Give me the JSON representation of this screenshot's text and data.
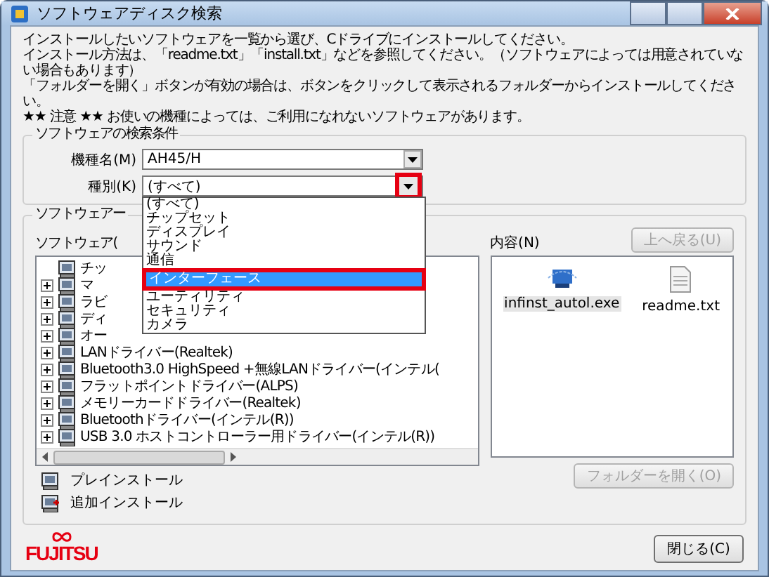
{
  "window": {
    "title": "ソフトウェアディスク検索"
  },
  "instructions": [
    "インストールしたいソフトウェアを一覧から選び、Cドライブにインストールしてください。",
    "インストール方法は、「readme.txt」「install.txt」などを参照してください。（ソフトウェアによっては用意されていない場合もあります）",
    "「フォルダーを開く」ボタンが有効の場合は、ボタンをクリックして表示されるフォルダーからインストールしてください。",
    "★★ 注意 ★★ お使いの機種によっては、ご利用になれないソフトウェアがあります。"
  ],
  "search_conditions": {
    "title": "ソフトウェアの検索条件",
    "fields": [
      {
        "label": "機種名(M)",
        "value": "AH45/H",
        "highlighted": false
      },
      {
        "label": "種別(K)",
        "value": "(すべて)",
        "highlighted": true,
        "expanded": true
      }
    ],
    "dropdown": [
      {
        "label": "(すべて)",
        "selected": false
      },
      {
        "label": "チップセット",
        "selected": false
      },
      {
        "label": "ディスプレイ",
        "selected": false
      },
      {
        "label": "サウンド",
        "selected": false
      },
      {
        "label": "通信",
        "selected": false
      },
      {
        "label": "インターフェース",
        "selected": true
      },
      {
        "label": "ユーティリティ",
        "selected": false
      },
      {
        "label": "セキュリティ",
        "selected": false
      },
      {
        "label": "カメラ",
        "selected": false
      }
    ]
  },
  "software": {
    "title": "ソフトウェアー",
    "list_label": "ソフトウェア(",
    "tree": [
      {
        "label": "チッ",
        "expandable": false
      },
      {
        "label": "マ",
        "expandable": true
      },
      {
        "label": "ラビ",
        "expandable": true
      },
      {
        "label": "ディ",
        "expandable": true
      },
      {
        "label": "オー",
        "expandable": true
      },
      {
        "label": "LANドライバー(Realtek)",
        "expandable": true
      },
      {
        "label": "Bluetooth3.0 HighSpeed +無線LANドライバー(インテル(",
        "expandable": true
      },
      {
        "label": "フラットポイントドライバー(ALPS)",
        "expandable": true
      },
      {
        "label": "メモリーカードドライバー(Realtek)",
        "expandable": true
      },
      {
        "label": "Bluetoothドライバー(インテル(R))",
        "expandable": true
      },
      {
        "label": "USB 3.0 ホストコントローラー用ドライバー(インテル(R))",
        "expandable": true
      }
    ],
    "contents_label": "内容(N)",
    "back_button": {
      "label": "上へ戻る(U)",
      "disabled": true
    },
    "files": [
      {
        "name": "infinst_autol.exe",
        "kind": "exe",
        "selected": true
      },
      {
        "name": "readme.txt",
        "kind": "txt",
        "selected": false
      }
    ],
    "open_folder_button": {
      "label": "フォルダーを開く(O)",
      "disabled": true
    },
    "legend": [
      {
        "label": "プレインストール",
        "kind": "preinstall"
      },
      {
        "label": "追加インストール",
        "kind": "additional"
      }
    ]
  },
  "footer": {
    "logo": "FUJITSU",
    "close_button": "閉じる(C)"
  }
}
